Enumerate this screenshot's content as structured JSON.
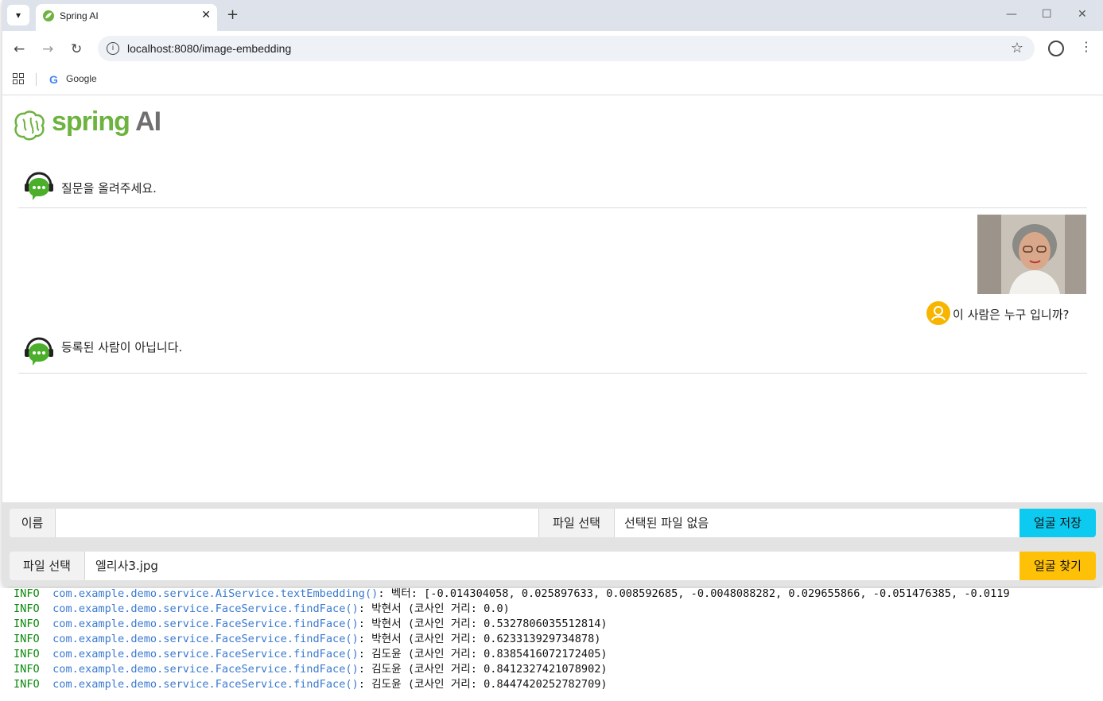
{
  "browser": {
    "tab_title": "Spring AI",
    "url": "localhost:8080/image-embedding",
    "bookmark_google": "Google",
    "new_tab": "+",
    "tab_close": "✕"
  },
  "logo": {
    "text_spring": "spring",
    "text_ai": "AI"
  },
  "chat": {
    "bot_greeting": "질문을 올려주세요.",
    "user_question": "이 사람은 누구 입니까?",
    "bot_answer": "등록된 사람이 아닙니다."
  },
  "register_form": {
    "name_label": "이름",
    "file_label": "파일 선택",
    "file_status": "선택된 파일 없음",
    "submit_label": "얼굴 저장",
    "submit_color": "#0dcaf0"
  },
  "search_form": {
    "file_label": "파일 선택",
    "file_name": "엘리사3.jpg",
    "submit_label": "얼굴 찾기",
    "submit_color": "#ffc107"
  },
  "console": {
    "lines": [
      {
        "level": "INFO",
        "source": "com.example.demo.service.AiService.textEmbedding()",
        "message": ": 벡터: [-0.014304058, 0.025897633, 0.008592685, -0.0048088282, 0.029655866, -0.051476385, -0.0119"
      },
      {
        "level": "INFO",
        "source": "com.example.demo.service.FaceService.findFace()",
        "message": ": 박현서 (코사인 거리: 0.0)"
      },
      {
        "level": "INFO",
        "source": "com.example.demo.service.FaceService.findFace()",
        "message": ": 박현서 (코사인 거리: 0.5327806035512814)"
      },
      {
        "level": "INFO",
        "source": "com.example.demo.service.FaceService.findFace()",
        "message": ": 박현서 (코사인 거리: 0.623313929734878)"
      },
      {
        "level": "INFO",
        "source": "com.example.demo.service.FaceService.findFace()",
        "message": ": 김도윤 (코사인 거리: 0.8385416072172405)"
      },
      {
        "level": "INFO",
        "source": "com.example.demo.service.FaceService.findFace()",
        "message": ": 김도윤 (코사인 거리: 0.8412327421078902)"
      },
      {
        "level": "INFO",
        "source": "com.example.demo.service.FaceService.findFace()",
        "message": ": 김도윤 (코사인 거리: 0.8447420252782709)"
      }
    ]
  }
}
